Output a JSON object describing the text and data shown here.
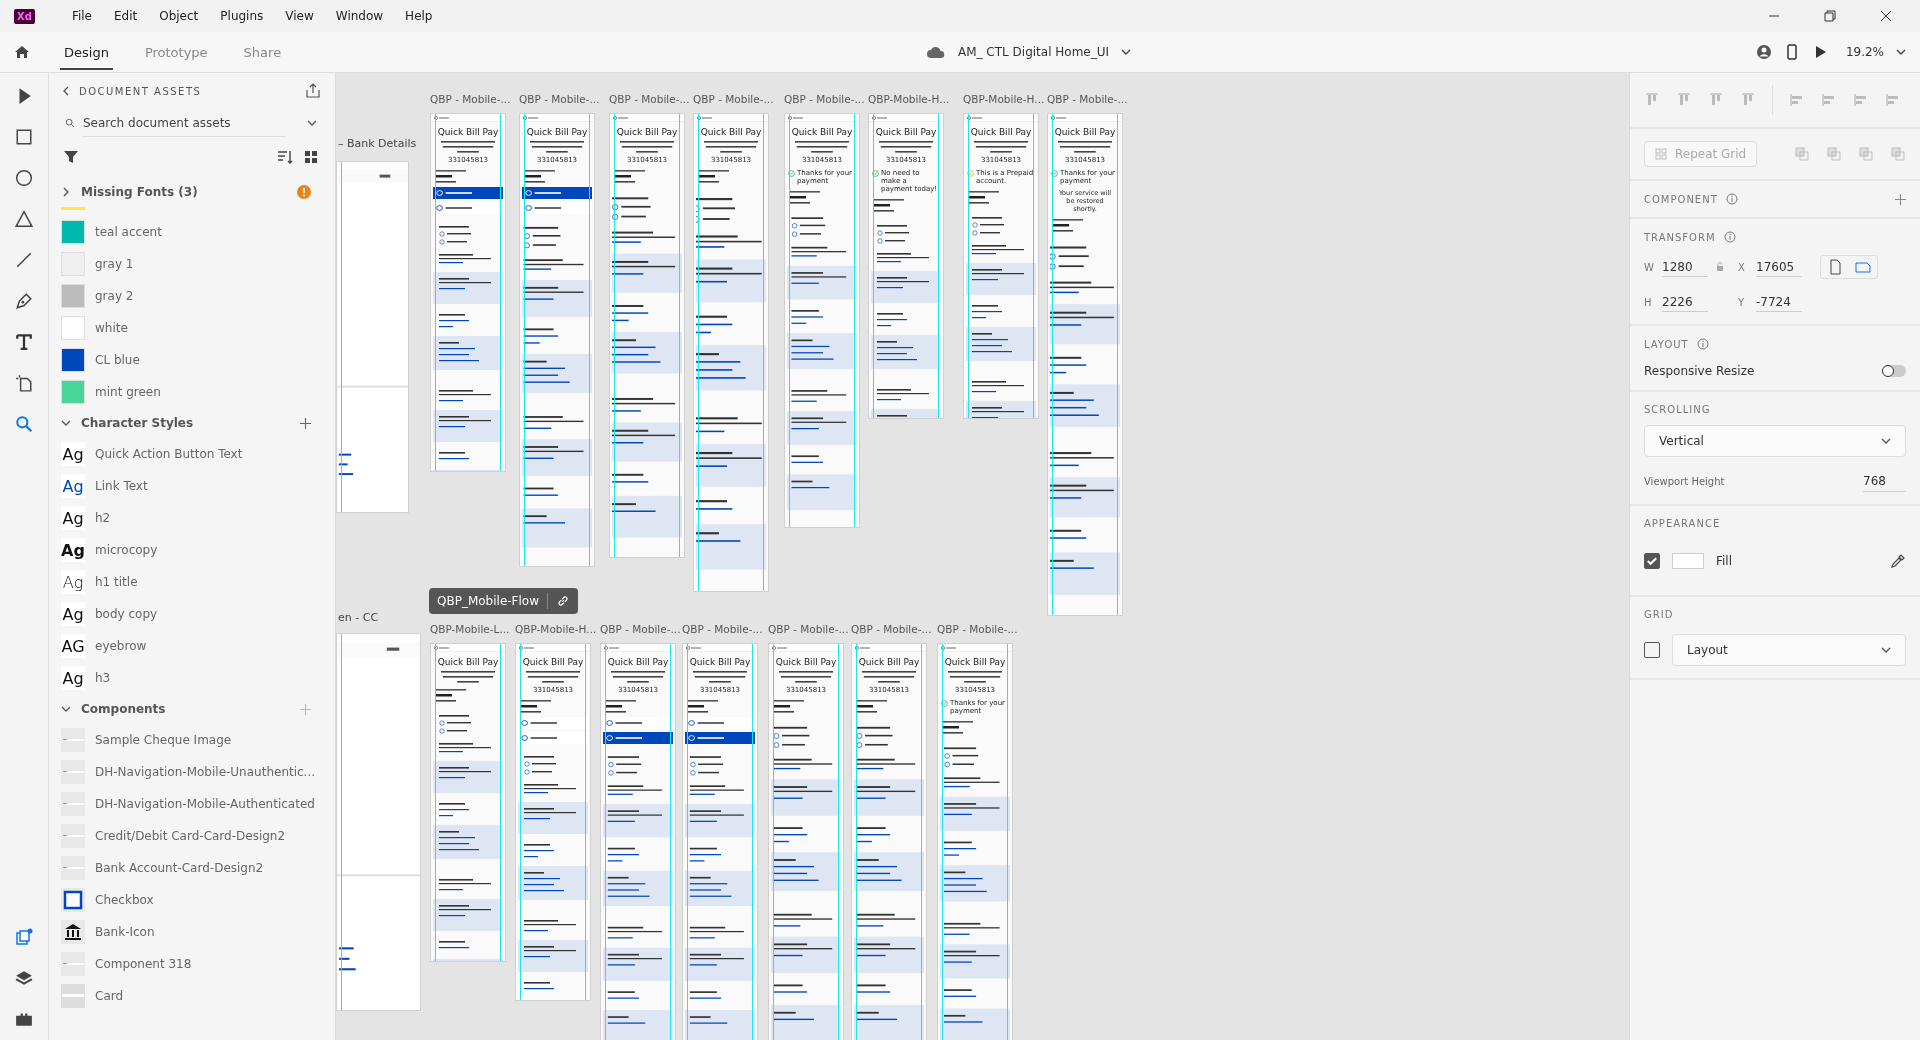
{
  "app": {
    "logo": "Xd",
    "menu": [
      "File",
      "Edit",
      "Object",
      "Plugins",
      "View",
      "Window",
      "Help"
    ]
  },
  "toolbar": {
    "tabs": [
      {
        "label": "Design",
        "selected": true
      },
      {
        "label": "Prototype",
        "selected": false
      },
      {
        "label": "Share",
        "selected": false
      }
    ],
    "document_title": "AM_ CTL Digital Home_UI",
    "zoom": "19.2%"
  },
  "assets": {
    "title": "DOCUMENT ASSETS",
    "search": {
      "placeholder": "Search document assets"
    },
    "missing_fonts": {
      "label": "Missing Fonts (3)",
      "expanded": false
    },
    "colors": [
      {
        "name": "teal accent",
        "color": "#00b9ae"
      },
      {
        "name": "gray 1",
        "color": "#efefef"
      },
      {
        "name": "gray 2",
        "color": "#bbbbbb"
      },
      {
        "name": "white",
        "color": "#ffffff"
      },
      {
        "name": "CL blue",
        "color": "#0047bb"
      },
      {
        "name": "mint green",
        "color": "#48d597"
      }
    ],
    "character_styles": {
      "label": "Character Styles",
      "expanded": true,
      "items": [
        {
          "sample": "Ag",
          "name": "Quick Action Button Text",
          "kind": "plain"
        },
        {
          "sample": "Ag",
          "name": "Link Text",
          "kind": "link"
        },
        {
          "sample": "Ag",
          "name": "h2",
          "kind": "plain"
        },
        {
          "sample": "Ag",
          "name": "microcopy",
          "kind": "bold"
        },
        {
          "sample": "Ag",
          "name": "h1 title",
          "kind": "light"
        },
        {
          "sample": "Ag",
          "name": "body copy",
          "kind": "plain"
        },
        {
          "sample": "AG",
          "name": "eyebrow",
          "kind": "plain"
        },
        {
          "sample": "Ag",
          "name": "h3",
          "kind": "plain"
        }
      ]
    },
    "components": {
      "label": "Components",
      "expanded": true,
      "items": [
        {
          "name": "Sample Cheque Image",
          "kind": "thumb"
        },
        {
          "name": "DH-Navigation-Mobile-Unauthentic...",
          "kind": "thumb"
        },
        {
          "name": "DH-Navigation-Mobile-Authenticated",
          "kind": "thumb"
        },
        {
          "name": "Credit/Debit Card-Card-Design2",
          "kind": "thumb"
        },
        {
          "name": "Bank Account-Card-Design2",
          "kind": "thumb"
        },
        {
          "name": "Checkbox",
          "kind": "checkbox"
        },
        {
          "name": "Bank-Icon",
          "kind": "bank"
        },
        {
          "name": "Component 318",
          "kind": "thumb"
        },
        {
          "name": "Card",
          "kind": "card"
        }
      ]
    }
  },
  "canvas": {
    "partial_labels": [
      "– Bank Details",
      "en - CC"
    ],
    "flow": {
      "name": "QBP_Mobile-Flow"
    },
    "artboards": [
      {
        "label": "QBP - Mobile-...",
        "title": "Quick Bill Pay",
        "account": "331045813",
        "methods": [
          {
            "selected": true
          },
          {
            "selected": false
          }
        ]
      },
      {
        "label": "QBP - Mobile-...",
        "title": "Quick Bill Pay",
        "account": "331045813",
        "methods": [
          {
            "selected": true
          },
          {
            "selected": false
          }
        ]
      },
      {
        "label": "QBP - Mobile-...",
        "title": "Quick Bill Pay",
        "account": "331045813"
      },
      {
        "label": "QBP - Mobile-...",
        "title": "Quick Bill Pay",
        "account": "331045813"
      },
      {
        "label": "QBP - Mobile-...",
        "title": "Quick Bill Pay",
        "account": "331045813",
        "status": {
          "kind": "success",
          "text": "Thanks for your payment"
        }
      },
      {
        "label": "QBP-Mobile-H...",
        "title": "Quick Bill Pay",
        "account": "331045813",
        "status": {
          "kind": "success",
          "text": "No need to make a payment today!"
        }
      },
      {
        "label": "QBP-Mobile-H...",
        "title": "Quick Bill Pay",
        "account": "331045813",
        "status": {
          "kind": "info",
          "text": "This is a Prepaid account."
        }
      },
      {
        "label": "QBP - Mobile-...",
        "title": "Quick Bill Pay",
        "account": "331045813",
        "status": {
          "kind": "success",
          "text": "Thanks for your payment"
        },
        "note": "Your service will be restored shortly."
      },
      {
        "label": "QBP-Mobile-L...",
        "title": "Quick Bill Pay"
      },
      {
        "label": "QBP-Mobile-H...",
        "title": "Quick Bill Pay",
        "account": "331045813",
        "methods": [
          {
            "selected": false
          },
          {
            "selected": false
          }
        ]
      },
      {
        "label": "QBP - Mobile-...",
        "title": "Quick Bill Pay",
        "account": "331045813",
        "methods": [
          {
            "selected": false
          },
          {
            "selected": true
          }
        ]
      },
      {
        "label": "QBP - Mobile-...",
        "title": "Quick Bill Pay",
        "account": "331045813",
        "methods": [
          {
            "selected": false
          },
          {
            "selected": true
          }
        ]
      },
      {
        "label": "QBP - Mobile-...",
        "title": "Quick Bill Pay",
        "account": "331045813"
      },
      {
        "label": "QBP - Mobile-...",
        "title": "Quick Bill Pay",
        "account": "331045813"
      },
      {
        "label": "QBP - Mobile-...",
        "title": "Quick Bill Pay",
        "account": "331045813",
        "status": {
          "kind": "success",
          "text": "Thanks for your payment"
        }
      }
    ]
  },
  "properties": {
    "repeat_grid": "Repeat Grid",
    "component": {
      "label": "COMPONENT"
    },
    "transform": {
      "label": "TRANSFORM",
      "w": {
        "label": "W",
        "value": "1280"
      },
      "x": {
        "label": "X",
        "value": "17605"
      },
      "h": {
        "label": "H",
        "value": "2226"
      },
      "y": {
        "label": "Y",
        "value": "-7724"
      }
    },
    "layout": {
      "label": "LAYOUT",
      "responsive_resize": {
        "label": "Responsive Resize",
        "on": false
      }
    },
    "scrolling": {
      "label": "SCROLLING",
      "value": "Vertical",
      "viewport_label": "Viewport Height",
      "viewport_value": "768"
    },
    "appearance": {
      "label": "APPEARANCE",
      "fill": {
        "label": "Fill",
        "checked": true
      }
    },
    "grid": {
      "label": "GRID",
      "checked": false,
      "value": "Layout"
    }
  }
}
